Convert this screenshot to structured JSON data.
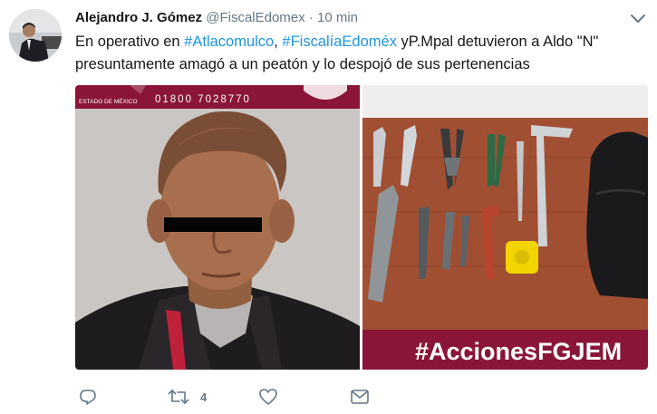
{
  "tweet": {
    "author_name": "Alejandro J. Gómez",
    "author_handle": "@FiscalEdomex",
    "separator": "·",
    "time": "10 min",
    "text_1": "En operativo en ",
    "hashtag_1": "#Atlacomulco",
    "text_2": ", ",
    "hashtag_2": "#FiscalíaEdoméx",
    "text_3": " yP.Mpal detuvieron a Aldo \"N\" presuntamente amagó a un peatón y lo despojó de sus pertenencias"
  },
  "media": {
    "left": {
      "banner_state": "ESTADO DE MÉXICO",
      "banner_phone": "01800 7028770"
    },
    "right": {
      "hashtag_banner": "#AccionesFGJEM"
    }
  },
  "actions": {
    "reply_count": "",
    "retweet_count": "4",
    "like_count": ""
  },
  "colors": {
    "link": "#1b95e0",
    "muted": "#657786",
    "banner_maroon": "#8a1538"
  },
  "icons": {
    "reply": "reply-icon",
    "retweet": "retweet-icon",
    "like": "heart-icon",
    "dm": "envelope-icon",
    "menu": "chevron-down-icon"
  }
}
